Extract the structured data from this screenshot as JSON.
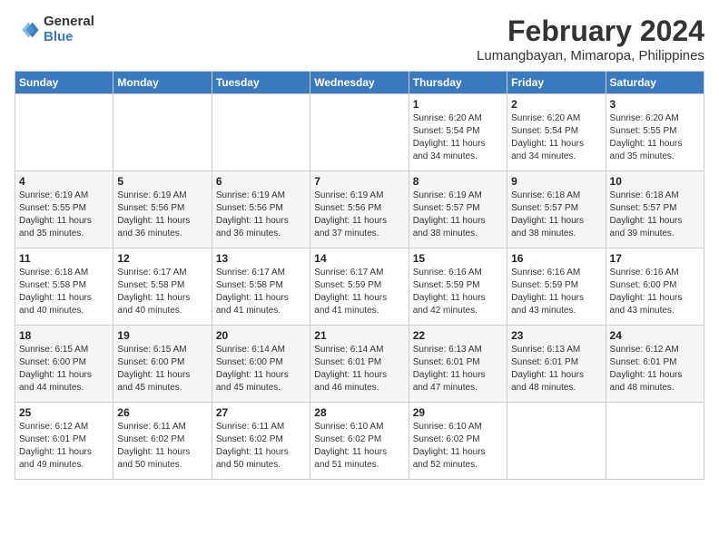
{
  "logo": {
    "general": "General",
    "blue": "Blue"
  },
  "title": "February 2024",
  "subtitle": "Lumangbayan, Mimaropa, Philippines",
  "header_days": [
    "Sunday",
    "Monday",
    "Tuesday",
    "Wednesday",
    "Thursday",
    "Friday",
    "Saturday"
  ],
  "weeks": [
    [
      {
        "day": "",
        "info": ""
      },
      {
        "day": "",
        "info": ""
      },
      {
        "day": "",
        "info": ""
      },
      {
        "day": "",
        "info": ""
      },
      {
        "day": "1",
        "info": "Sunrise: 6:20 AM\nSunset: 5:54 PM\nDaylight: 11 hours\nand 34 minutes."
      },
      {
        "day": "2",
        "info": "Sunrise: 6:20 AM\nSunset: 5:54 PM\nDaylight: 11 hours\nand 34 minutes."
      },
      {
        "day": "3",
        "info": "Sunrise: 6:20 AM\nSunset: 5:55 PM\nDaylight: 11 hours\nand 35 minutes."
      }
    ],
    [
      {
        "day": "4",
        "info": "Sunrise: 6:19 AM\nSunset: 5:55 PM\nDaylight: 11 hours\nand 35 minutes."
      },
      {
        "day": "5",
        "info": "Sunrise: 6:19 AM\nSunset: 5:56 PM\nDaylight: 11 hours\nand 36 minutes."
      },
      {
        "day": "6",
        "info": "Sunrise: 6:19 AM\nSunset: 5:56 PM\nDaylight: 11 hours\nand 36 minutes."
      },
      {
        "day": "7",
        "info": "Sunrise: 6:19 AM\nSunset: 5:56 PM\nDaylight: 11 hours\nand 37 minutes."
      },
      {
        "day": "8",
        "info": "Sunrise: 6:19 AM\nSunset: 5:57 PM\nDaylight: 11 hours\nand 38 minutes."
      },
      {
        "day": "9",
        "info": "Sunrise: 6:18 AM\nSunset: 5:57 PM\nDaylight: 11 hours\nand 38 minutes."
      },
      {
        "day": "10",
        "info": "Sunrise: 6:18 AM\nSunset: 5:57 PM\nDaylight: 11 hours\nand 39 minutes."
      }
    ],
    [
      {
        "day": "11",
        "info": "Sunrise: 6:18 AM\nSunset: 5:58 PM\nDaylight: 11 hours\nand 40 minutes."
      },
      {
        "day": "12",
        "info": "Sunrise: 6:17 AM\nSunset: 5:58 PM\nDaylight: 11 hours\nand 40 minutes."
      },
      {
        "day": "13",
        "info": "Sunrise: 6:17 AM\nSunset: 5:58 PM\nDaylight: 11 hours\nand 41 minutes."
      },
      {
        "day": "14",
        "info": "Sunrise: 6:17 AM\nSunset: 5:59 PM\nDaylight: 11 hours\nand 41 minutes."
      },
      {
        "day": "15",
        "info": "Sunrise: 6:16 AM\nSunset: 5:59 PM\nDaylight: 11 hours\nand 42 minutes."
      },
      {
        "day": "16",
        "info": "Sunrise: 6:16 AM\nSunset: 5:59 PM\nDaylight: 11 hours\nand 43 minutes."
      },
      {
        "day": "17",
        "info": "Sunrise: 6:16 AM\nSunset: 6:00 PM\nDaylight: 11 hours\nand 43 minutes."
      }
    ],
    [
      {
        "day": "18",
        "info": "Sunrise: 6:15 AM\nSunset: 6:00 PM\nDaylight: 11 hours\nand 44 minutes."
      },
      {
        "day": "19",
        "info": "Sunrise: 6:15 AM\nSunset: 6:00 PM\nDaylight: 11 hours\nand 45 minutes."
      },
      {
        "day": "20",
        "info": "Sunrise: 6:14 AM\nSunset: 6:00 PM\nDaylight: 11 hours\nand 45 minutes."
      },
      {
        "day": "21",
        "info": "Sunrise: 6:14 AM\nSunset: 6:01 PM\nDaylight: 11 hours\nand 46 minutes."
      },
      {
        "day": "22",
        "info": "Sunrise: 6:13 AM\nSunset: 6:01 PM\nDaylight: 11 hours\nand 47 minutes."
      },
      {
        "day": "23",
        "info": "Sunrise: 6:13 AM\nSunset: 6:01 PM\nDaylight: 11 hours\nand 48 minutes."
      },
      {
        "day": "24",
        "info": "Sunrise: 6:12 AM\nSunset: 6:01 PM\nDaylight: 11 hours\nand 48 minutes."
      }
    ],
    [
      {
        "day": "25",
        "info": "Sunrise: 6:12 AM\nSunset: 6:01 PM\nDaylight: 11 hours\nand 49 minutes."
      },
      {
        "day": "26",
        "info": "Sunrise: 6:11 AM\nSunset: 6:02 PM\nDaylight: 11 hours\nand 50 minutes."
      },
      {
        "day": "27",
        "info": "Sunrise: 6:11 AM\nSunset: 6:02 PM\nDaylight: 11 hours\nand 50 minutes."
      },
      {
        "day": "28",
        "info": "Sunrise: 6:10 AM\nSunset: 6:02 PM\nDaylight: 11 hours\nand 51 minutes."
      },
      {
        "day": "29",
        "info": "Sunrise: 6:10 AM\nSunset: 6:02 PM\nDaylight: 11 hours\nand 52 minutes."
      },
      {
        "day": "",
        "info": ""
      },
      {
        "day": "",
        "info": ""
      }
    ]
  ]
}
